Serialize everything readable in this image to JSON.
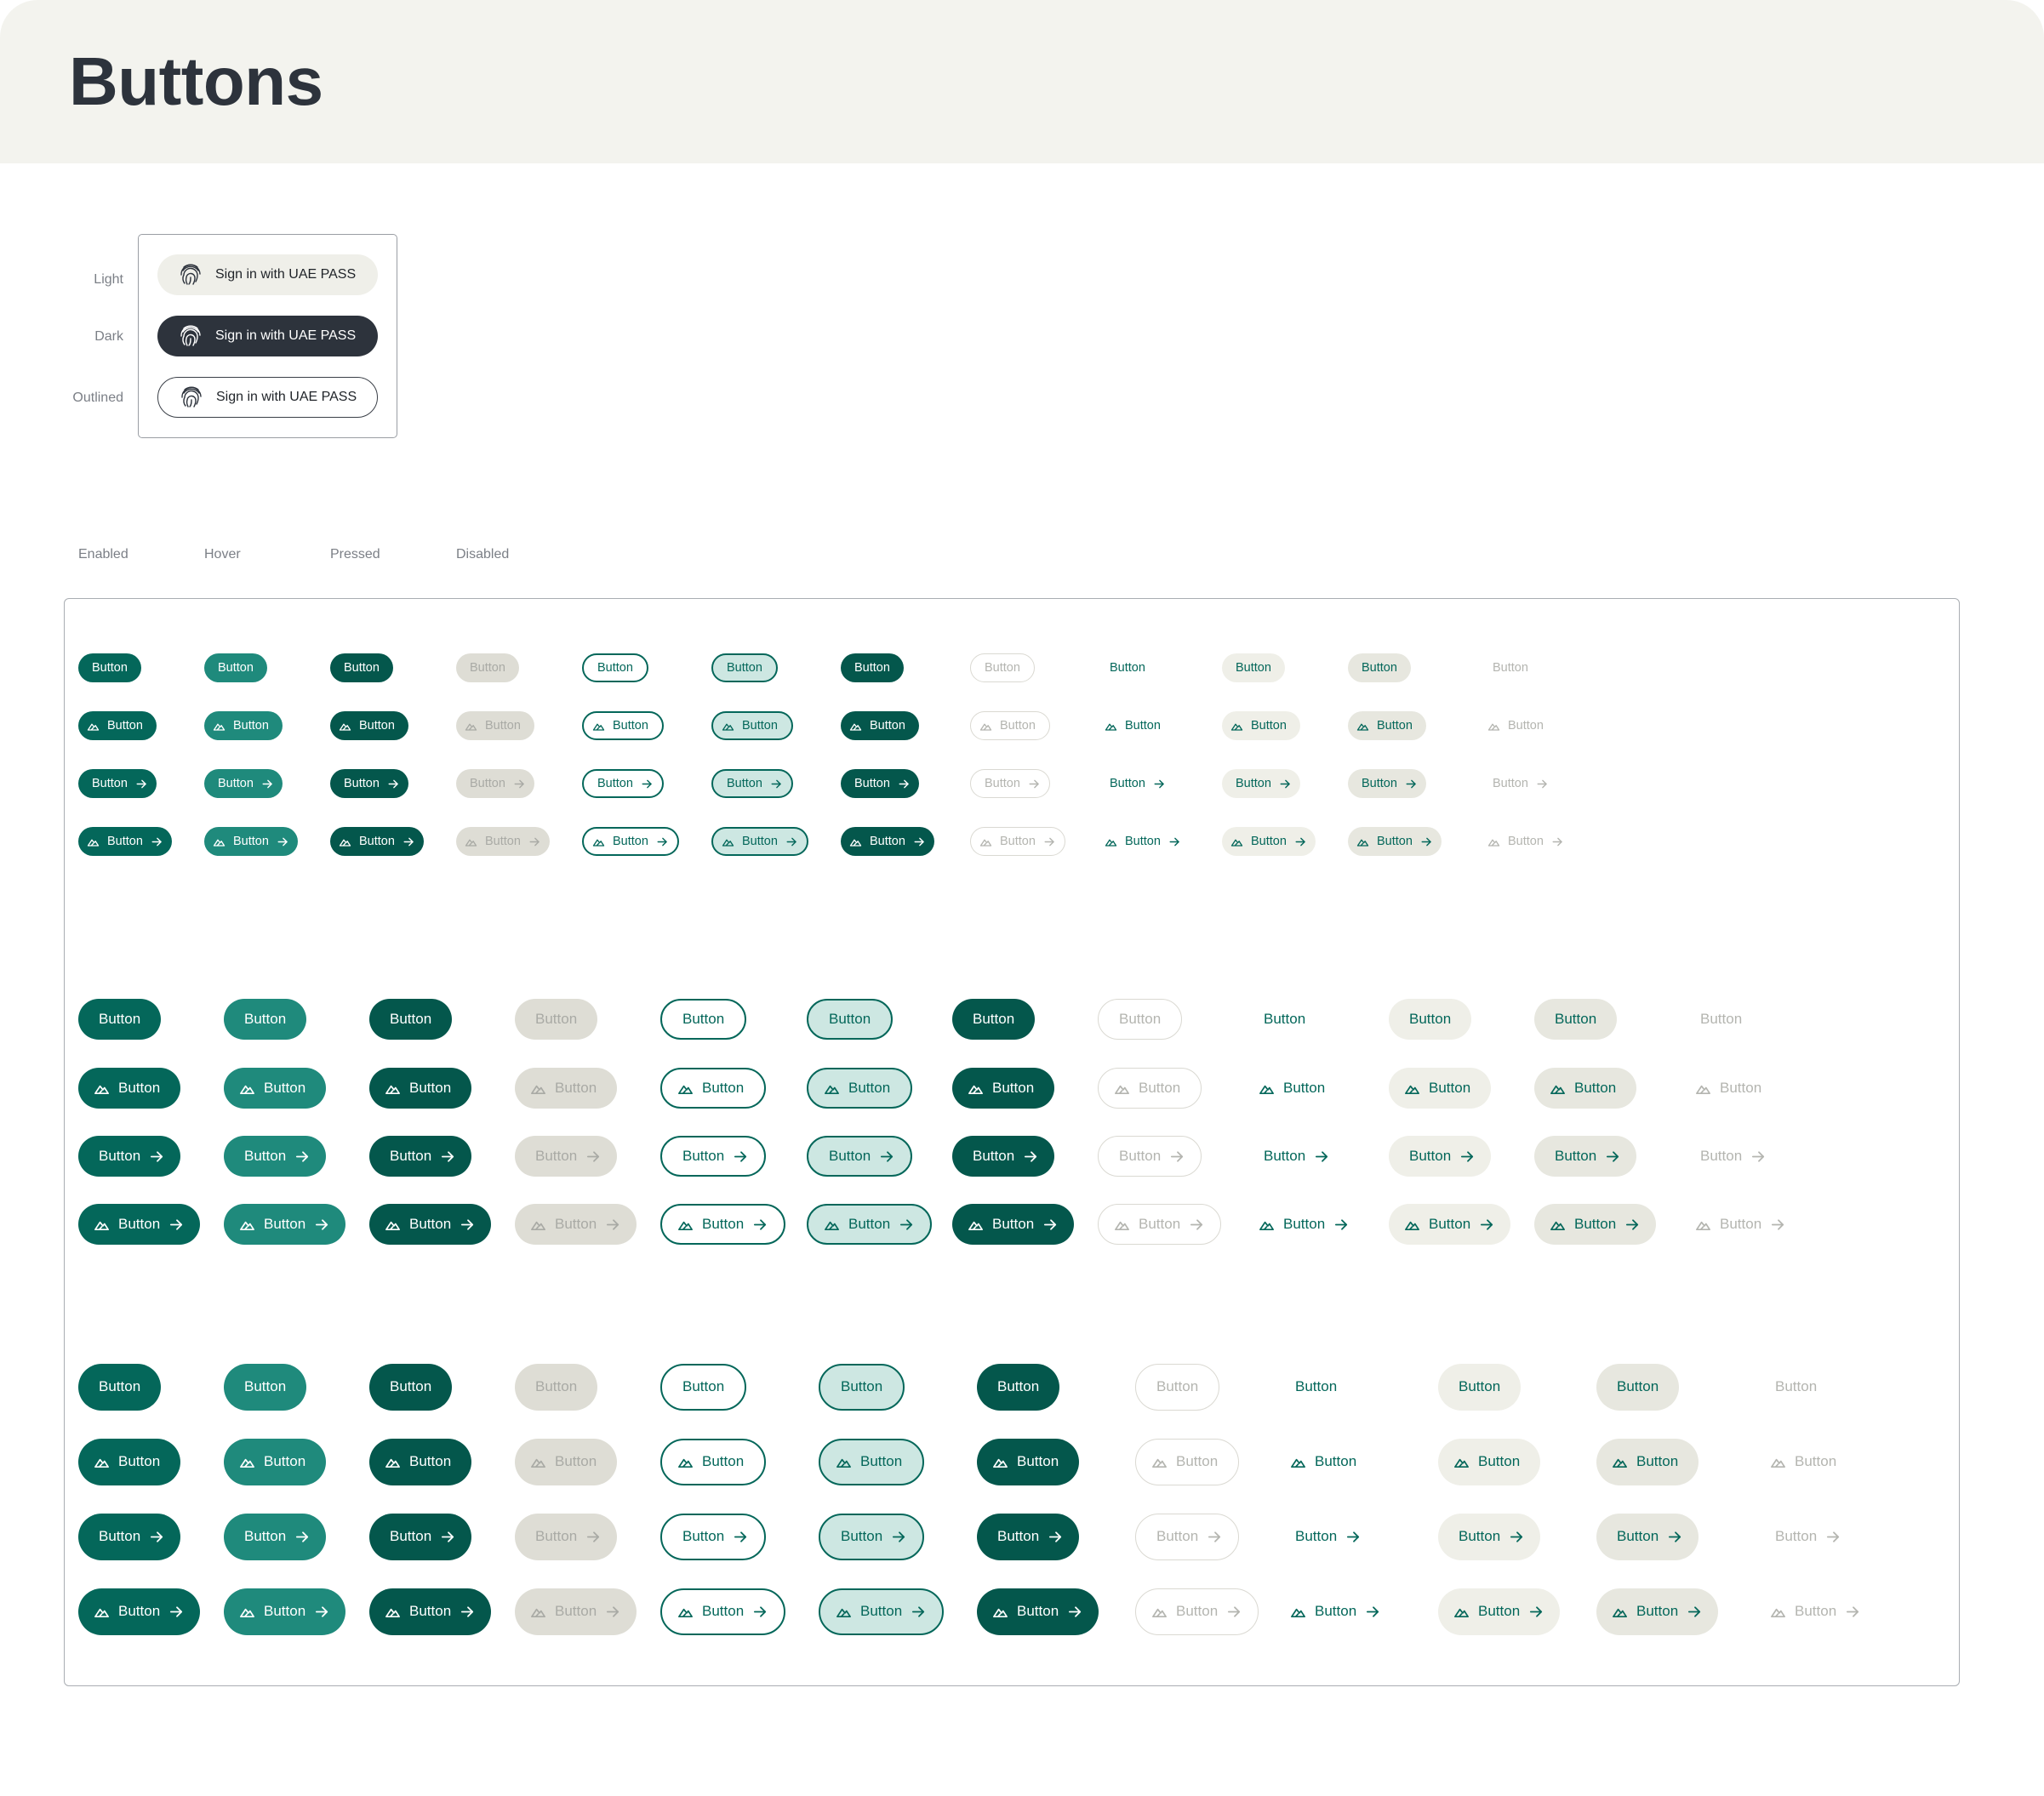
{
  "page": {
    "title": "Buttons"
  },
  "uae_pass": {
    "labels": {
      "light": "Light",
      "dark": "Dark",
      "outlined": "Outlined"
    },
    "button_text": "Sign in with UAE PASS",
    "icon": "fingerprint-icon"
  },
  "states": [
    "Enabled",
    "Hover",
    "Pressed",
    "Disabled"
  ],
  "button_text": "Button",
  "icons": {
    "leading": "mountain-icon",
    "trailing": "arrow-right-icon"
  },
  "colors": {
    "primary": "#04675a",
    "primary_hover": "#1f8a7c",
    "primary_pressed": "#04574c",
    "outline_hover_bg": "#cde7e2",
    "disabled_bg": "#deddd5",
    "disabled_text": "#a9aaa5",
    "tertiary_hover_bg": "#efefe8",
    "dark": "#2d333c",
    "light_bg": "#f3f3ee"
  },
  "variants": [
    "filled",
    "outlined",
    "text"
  ],
  "sizes": [
    "small",
    "medium",
    "large"
  ]
}
